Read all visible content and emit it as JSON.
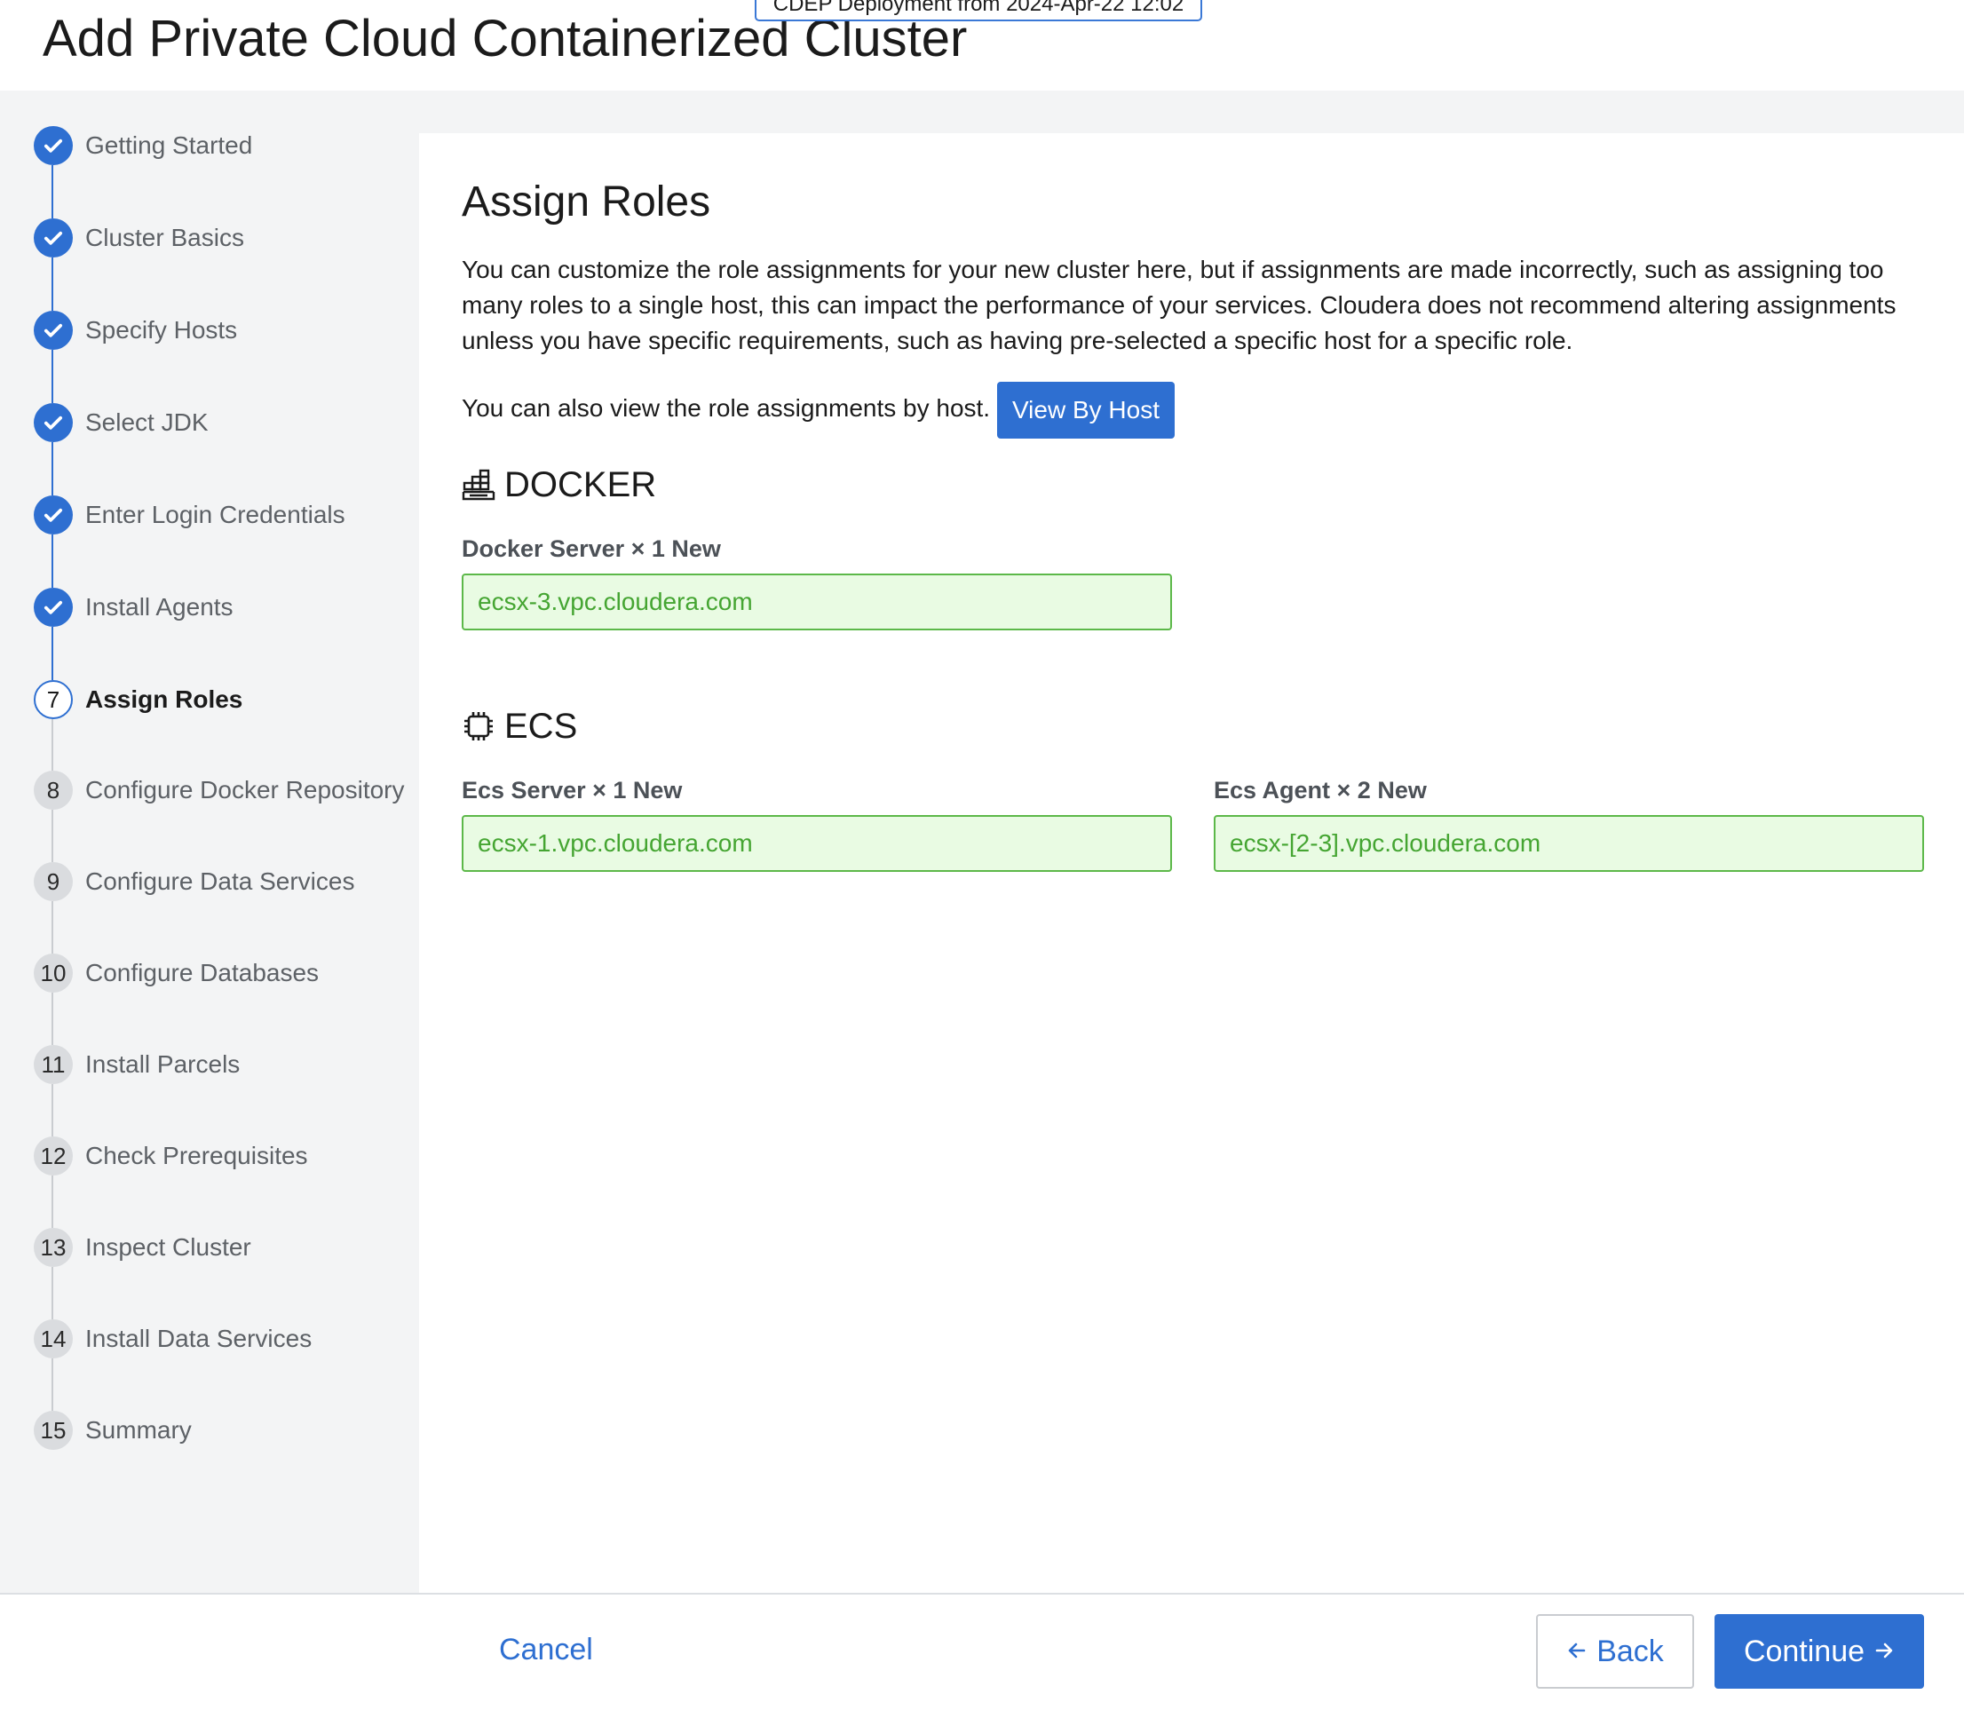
{
  "header": {
    "title": "Add Private Cloud Containerized Cluster",
    "deployment_badge": "CDEP Deployment from 2024-Apr-22 12:02"
  },
  "steps": [
    {
      "number": "1",
      "label": "Getting Started",
      "status": "completed"
    },
    {
      "number": "2",
      "label": "Cluster Basics",
      "status": "completed"
    },
    {
      "number": "3",
      "label": "Specify Hosts",
      "status": "completed"
    },
    {
      "number": "4",
      "label": "Select JDK",
      "status": "completed"
    },
    {
      "number": "5",
      "label": "Enter Login Credentials",
      "status": "completed"
    },
    {
      "number": "6",
      "label": "Install Agents",
      "status": "completed"
    },
    {
      "number": "7",
      "label": "Assign Roles",
      "status": "current"
    },
    {
      "number": "8",
      "label": "Configure Docker Repository",
      "status": "pending"
    },
    {
      "number": "9",
      "label": "Configure Data Services",
      "status": "pending"
    },
    {
      "number": "10",
      "label": "Configure Databases",
      "status": "pending"
    },
    {
      "number": "11",
      "label": "Install Parcels",
      "status": "pending"
    },
    {
      "number": "12",
      "label": "Check Prerequisites",
      "status": "pending"
    },
    {
      "number": "13",
      "label": "Inspect Cluster",
      "status": "pending"
    },
    {
      "number": "14",
      "label": "Install Data Services",
      "status": "pending"
    },
    {
      "number": "15",
      "label": "Summary",
      "status": "pending"
    }
  ],
  "main": {
    "title": "Assign Roles",
    "description": "You can customize the role assignments for your new cluster here, but if assignments are made incorrectly, such as assigning too many roles to a single host, this can impact the performance of your services. Cloudera does not recommend altering assignments unless you have specific requirements, such as having pre-selected a specific host for a specific role.",
    "by_host_text": "You can also view the role assignments by host.",
    "view_by_host_label": "View By Host"
  },
  "services": [
    {
      "name": "DOCKER",
      "icon": "docker-icon",
      "roles": [
        {
          "label": "Docker Server × 1 New",
          "hosts": "ecsx-3.vpc.cloudera.com"
        }
      ]
    },
    {
      "name": "ECS",
      "icon": "chip-icon",
      "roles": [
        {
          "label": "Ecs Server × 1 New",
          "hosts": "ecsx-1.vpc.cloudera.com"
        },
        {
          "label": "Ecs Agent × 2 New",
          "hosts": "ecsx-[2-3].vpc.cloudera.com"
        }
      ]
    }
  ],
  "footer": {
    "cancel_label": "Cancel",
    "back_label": "Back",
    "continue_label": "Continue"
  },
  "colors": {
    "accent": "#2e6fd1",
    "assigned_field_bg": "#e9fbe3",
    "assigned_field_border": "#5cb849",
    "assigned_field_text": "#45a532"
  }
}
